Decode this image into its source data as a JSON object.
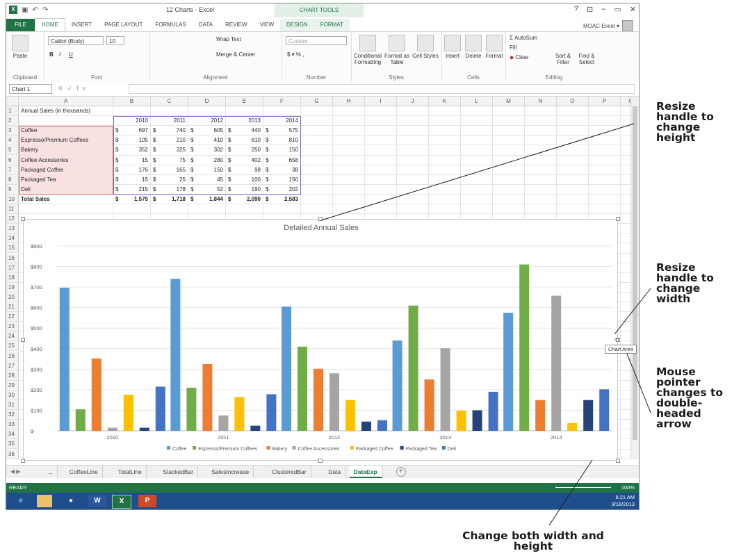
{
  "window": {
    "title": "12 Charts - Excel",
    "context_group": "CHART TOOLS",
    "controls": [
      "?",
      "⊡",
      "–",
      "▭",
      "✕"
    ],
    "account": "MOAC Excel ▾"
  },
  "tabs": [
    "FILE",
    "HOME",
    "INSERT",
    "PAGE LAYOUT",
    "FORMULAS",
    "DATA",
    "REVIEW",
    "VIEW",
    "DESIGN",
    "FORMAT"
  ],
  "ribbon": {
    "clipboard": {
      "paste": "Paste",
      "name": "Clipboard"
    },
    "font": {
      "family": "Calibri (Body)",
      "size": "10",
      "name": "Font",
      "bold": "B",
      "italic": "I",
      "underline": "U"
    },
    "alignment": {
      "wrap": "Wrap Text",
      "merge": "Merge & Center",
      "name": "Alignment"
    },
    "number": {
      "format": "Custom",
      "currency": "$ ▾ % ,",
      "name": "Number"
    },
    "styles": {
      "conditional": "Conditional Formatting",
      "format_as": "Format as Table",
      "cell": "Cell Styles",
      "name": "Styles"
    },
    "cells": {
      "insert": "Insert",
      "delete": "Delete",
      "format": "Format",
      "name": "Cells"
    },
    "editing": {
      "autosum": "AutoSum",
      "fill": "Fill",
      "clear": "Clear",
      "sort": "Sort & Filter",
      "find": "Find & Select",
      "name": "Editing"
    }
  },
  "formula_bar": {
    "name_box": "Chart 1",
    "fx": "fx",
    "value": ""
  },
  "grid": {
    "columns": [
      "A",
      "B",
      "C",
      "D",
      "E",
      "F",
      "G",
      "H",
      "I",
      "J",
      "K",
      "L",
      "M",
      "N",
      "O",
      "P",
      "Q"
    ],
    "rows": [
      "1",
      "2",
      "3",
      "4",
      "5",
      "6",
      "7",
      "8",
      "9",
      "10",
      "11",
      "12",
      "13",
      "14",
      "15",
      "16",
      "17",
      "18",
      "19",
      "20",
      "21",
      "22",
      "23",
      "24",
      "25",
      "26",
      "27",
      "28",
      "29",
      "30",
      "31",
      "32",
      "33",
      "34",
      "35",
      "36"
    ],
    "a1": "Annual Sales (in thousands)",
    "years": [
      "2010",
      "2011",
      "2012",
      "2013",
      "2014"
    ],
    "table": [
      {
        "label": "Coffee",
        "values": [
          "697",
          "740",
          "605",
          "440",
          "575"
        ]
      },
      {
        "label": "Espresso/Premium Coffees",
        "values": [
          "105",
          "210",
          "410",
          "610",
          "810"
        ]
      },
      {
        "label": "Bakery",
        "values": [
          "352",
          "325",
          "302",
          "250",
          "150"
        ]
      },
      {
        "label": "Coffee Accessories",
        "values": [
          "15",
          "75",
          "280",
          "402",
          "658"
        ]
      },
      {
        "label": "Packaged Coffee",
        "values": [
          "176",
          "165",
          "150",
          "98",
          "38"
        ]
      },
      {
        "label": "Packaged Tea",
        "values": [
          "15",
          "25",
          "45",
          "100",
          "150"
        ]
      },
      {
        "label": "Deli",
        "values": [
          "215",
          "178",
          "52",
          "190",
          "202"
        ]
      }
    ],
    "total_label": "Total Sales",
    "totals": [
      "1,575",
      "1,718",
      "1,844",
      "2,090",
      "2,583"
    ],
    "currency": "$"
  },
  "chart_data": {
    "type": "bar",
    "title": "Detailed Annual Sales",
    "categories": [
      "2010",
      "2011",
      "2012",
      "2013",
      "2014"
    ],
    "y_ticks": [
      "$-",
      "$100",
      "$200",
      "$300",
      "$400",
      "$500",
      "$600",
      "$700",
      "$800",
      "$900"
    ],
    "ylim": [
      0,
      900
    ],
    "legend_position": "bottom",
    "grid": true,
    "series": [
      {
        "name": "Coffee",
        "color": "#5b9bd5",
        "values": [
          697,
          740,
          605,
          440,
          575
        ]
      },
      {
        "name": "Espresso/Premium Coffees",
        "color": "#70ad47",
        "values": [
          105,
          210,
          410,
          610,
          810
        ]
      },
      {
        "name": "Bakery",
        "color": "#ed7d31",
        "values": [
          352,
          325,
          302,
          250,
          150
        ]
      },
      {
        "name": "Coffee Accessories",
        "color": "#a5a5a5",
        "values": [
          15,
          75,
          280,
          402,
          658
        ]
      },
      {
        "name": "Packaged Coffee",
        "color": "#ffc000",
        "values": [
          176,
          165,
          150,
          98,
          38
        ]
      },
      {
        "name": "Packaged Tea",
        "color": "#264478",
        "values": [
          15,
          25,
          45,
          100,
          150
        ]
      },
      {
        "name": "Deli",
        "color": "#4472c4",
        "values": [
          215,
          178,
          52,
          190,
          202
        ]
      }
    ]
  },
  "tooltip": "Chart Area",
  "sheet_tabs": [
    "...",
    "CoffeeLine",
    "TotalLine",
    "StackedBar",
    "SalesIncrease",
    "ClusteredBar",
    "Data",
    "DataExp"
  ],
  "active_sheet": "DataExp",
  "status": {
    "ready": "READY",
    "zoom": "100%"
  },
  "taskbar": {
    "time": "6:21 AM",
    "date": "3/18/2013"
  },
  "callouts": {
    "height": "Resize handle to change height",
    "width": "Resize handle to change width",
    "pointer": "Mouse pointer changes to double-headed arrow",
    "both": "Change both width and height"
  }
}
